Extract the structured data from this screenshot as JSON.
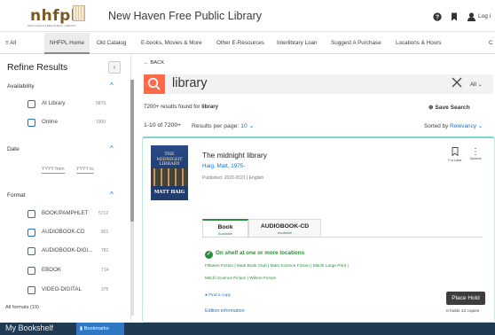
{
  "header": {
    "logo": "nhfpl",
    "logo_sub": "NEW HAVEN FREE PUBLIC LIBRARY",
    "site_title": "New Haven Free Public Library",
    "help_icon": "help-circle-icon",
    "bookmark_icon": "bookmark-icon",
    "user_icon": "user-icon",
    "login_label": "Log i"
  },
  "nav": {
    "items": [
      {
        "label": "≡ All"
      },
      {
        "label": "NHFPL Home"
      },
      {
        "label": "Old Catalog"
      },
      {
        "label": "E-books, Movies & More"
      },
      {
        "label": "Other E-Resources"
      },
      {
        "label": "Interlibrary Loan"
      },
      {
        "label": "Suggest A Purchase"
      },
      {
        "label": "Locations & Hours"
      },
      {
        "label": "C"
      }
    ]
  },
  "sidebar": {
    "title": "Refine Results",
    "collapse_glyph": "‹",
    "availability": {
      "heading": "Availability",
      "options": [
        {
          "label": "At Library",
          "count": "5870"
        },
        {
          "label": "Online",
          "count": "1900"
        }
      ]
    },
    "date": {
      "heading": "Date",
      "from_placeholder": "YYYY from",
      "to_placeholder": "YYYY to"
    },
    "format": {
      "heading": "Format",
      "options": [
        {
          "label": "BOOK/PAMPHLET",
          "count": "5712"
        },
        {
          "label": "AUDIOBOOK-CD",
          "count": "851"
        },
        {
          "label": "AUDIOBOOK-DIGI...",
          "count": "781"
        },
        {
          "label": "EBOOK",
          "count": "714"
        },
        {
          "label": "VIDEO-DIGITAL",
          "count": "375"
        }
      ],
      "all_formats": "All formats (19)"
    }
  },
  "main": {
    "back_label": "← BACK",
    "search_value": "library",
    "search_scope": "All",
    "results_found_prefix": "7200+ results found for",
    "results_found_term": "library",
    "save_search": "Save Search",
    "range": "1-10 of 7200+",
    "per_page_label": "Results per page:",
    "per_page_value": "10",
    "sorted_label": "Sorted by",
    "sorted_value": "Relevancy"
  },
  "result": {
    "cover_title": "THE MIDNIGHT LIBRARY",
    "cover_author": "MATT HAIG",
    "title": "The midnight library",
    "author": "Haig, Matt, 1975-",
    "published": "Published: 2020-2021 | English",
    "for_later": "For Later",
    "options": "Options",
    "tabs": [
      {
        "label": "Book",
        "sub": "Available"
      },
      {
        "label": "AUDIOBOOK-CD",
        "sub": "Available"
      }
    ],
    "shelf_status": "On shelf at one or more locations",
    "branches_line1": "Fitkwen Fiction | Main Book Club | Main Science Fiction | Mitchl Large Print |",
    "branches_line2": "Mitchl Science Fiction | Wilson Fiction",
    "find_copy": "Find a copy",
    "edition_info": "Edition information",
    "place_hold": "Place Hold",
    "holds": "0 holds  12 copies"
  },
  "bottom_bar": {
    "label": "My Bookshelf",
    "tab": "Bookmarks"
  },
  "colors": {
    "accent_blue": "#1b72c2",
    "search_orange": "#ff6b4a",
    "available_green": "#2e8b3c",
    "card_border": "#7ad4cf",
    "bottom_bar": "#1f3a52"
  }
}
